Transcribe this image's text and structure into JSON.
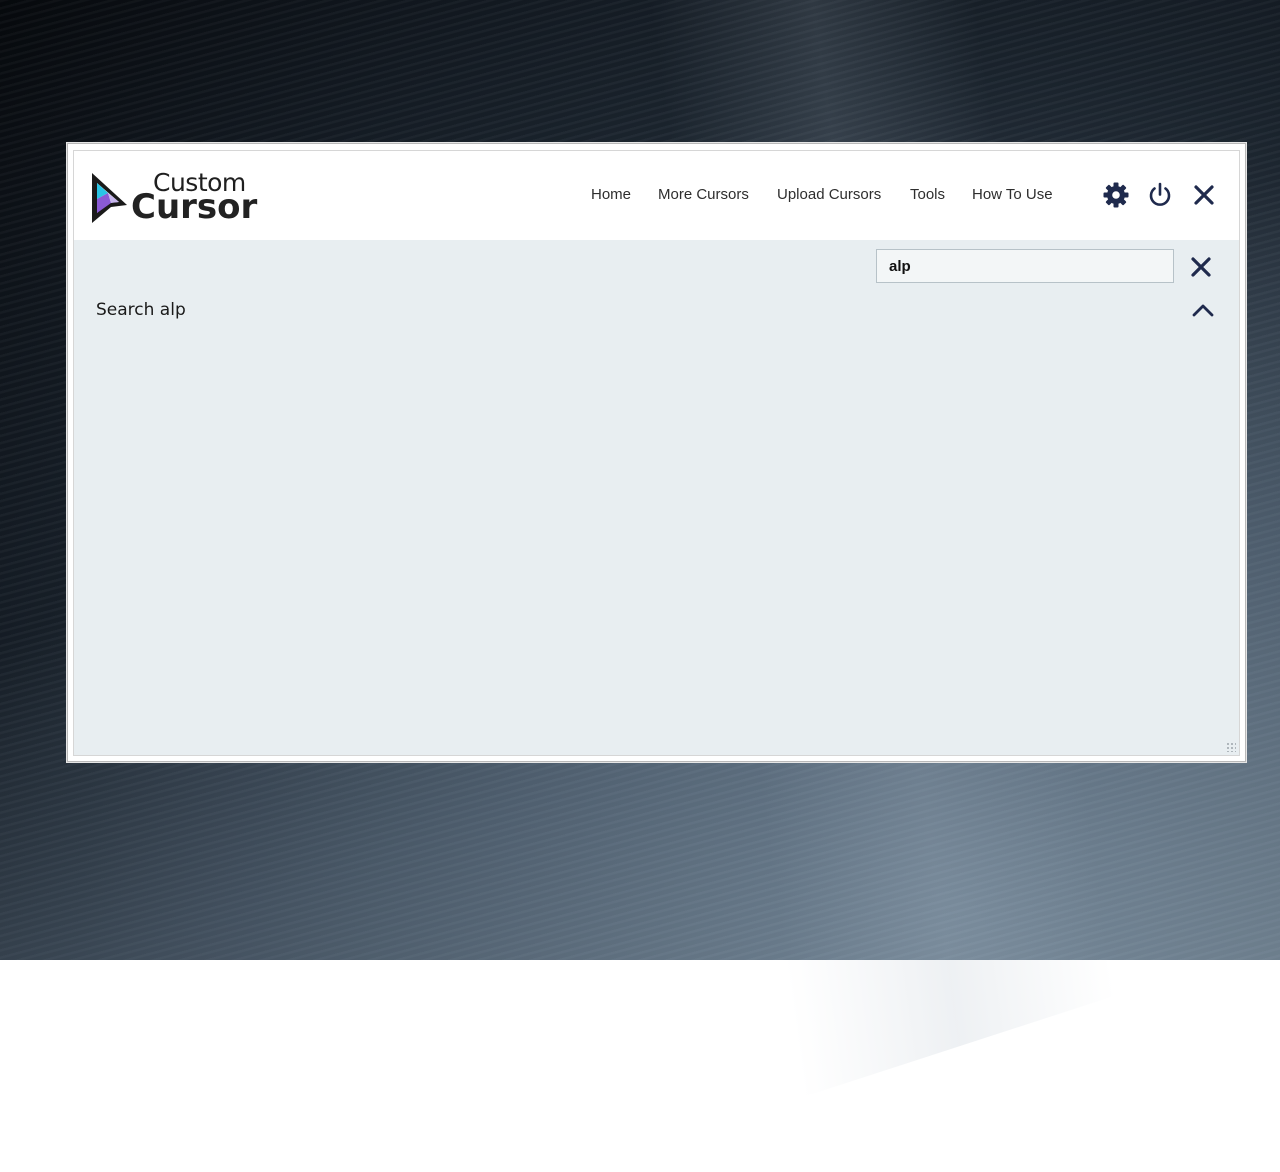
{
  "app": {
    "logo_line1": "Custom",
    "logo_line2": "Cursor"
  },
  "nav": {
    "items": [
      {
        "label": "Home"
      },
      {
        "label": "More Cursors"
      },
      {
        "label": "Upload Cursors"
      },
      {
        "label": "Tools"
      },
      {
        "label": "How To Use"
      }
    ]
  },
  "header_icons": [
    "gear-icon",
    "power-icon",
    "close-icon"
  ],
  "search": {
    "value": "alp"
  },
  "results": {
    "title": "Search alp"
  },
  "colors": {
    "icon": "#1f2a4d",
    "content_bg": "#e8eef1",
    "logo_cyan": "#29c5e6",
    "logo_purple": "#8a5ad6"
  }
}
